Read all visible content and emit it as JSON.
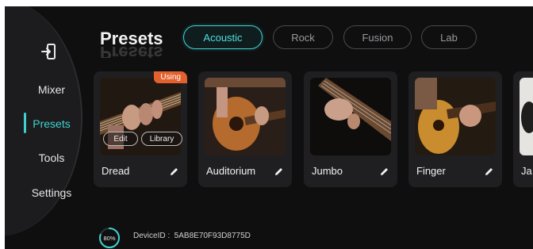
{
  "sidebar": {
    "items": [
      {
        "label": "Mixer"
      },
      {
        "label": "Presets"
      },
      {
        "label": "Tools"
      },
      {
        "label": "Settings"
      }
    ]
  },
  "header": {
    "title": "Presets",
    "tabs": [
      {
        "label": "Acoustic"
      },
      {
        "label": "Rock"
      },
      {
        "label": "Fusion"
      },
      {
        "label": "Lab"
      }
    ]
  },
  "cards": [
    {
      "name": "Dread",
      "badge": "Using",
      "edit_label": "Edit",
      "library_label": "Library"
    },
    {
      "name": "Auditorium"
    },
    {
      "name": "Jumbo"
    },
    {
      "name": "Finger"
    },
    {
      "name": "Ja"
    }
  ],
  "footer": {
    "progress_text": "80%",
    "progress_value": 0.8,
    "device_label": "DeviceID :  5AB8E70F93D8775D"
  },
  "colors": {
    "accent": "#3fd1cf",
    "badge": "#e2612e",
    "background": "#0f0f10"
  }
}
